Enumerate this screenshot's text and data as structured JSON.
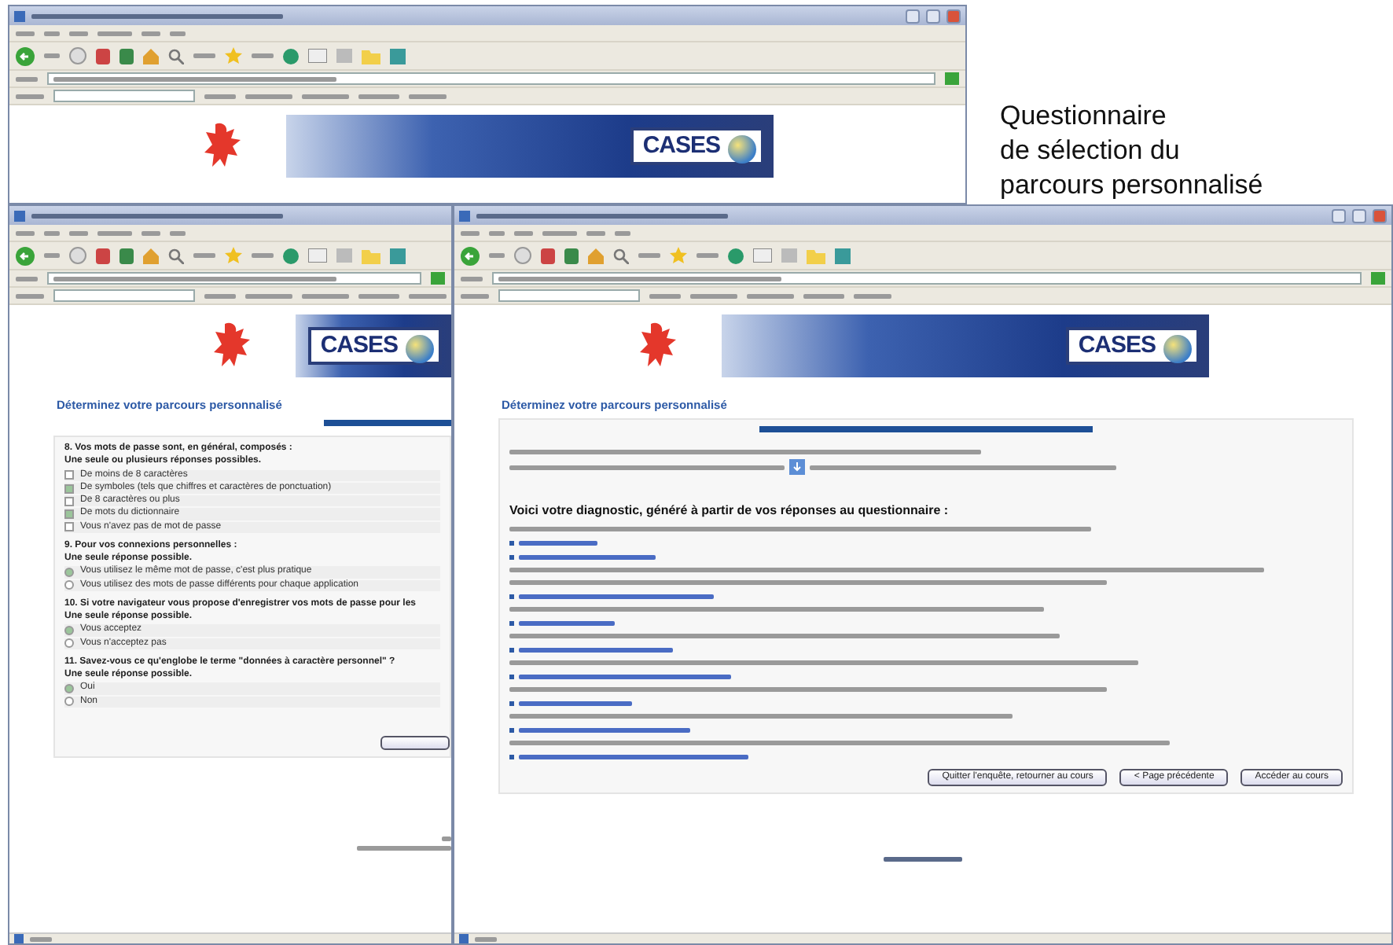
{
  "caption": "Questionnaire\nde sélection du\nparcours personnalisé",
  "windows": [
    {
      "kind": "banner",
      "window_buttons": true,
      "logo": "CASES"
    },
    {
      "kind": "questionnaire",
      "logo": "CASES",
      "heading": "Déterminez votre parcours personnalisé",
      "progress": {
        "level": 1
      },
      "questions": [
        {
          "title": "8. Vos mots de passe sont, en général, composés :",
          "hint": "Une seule ou plusieurs réponses possibles.",
          "kind": "checkbox",
          "options": [
            {
              "label": "De moins de 8 caractères",
              "checked": false
            },
            {
              "label": "De symboles (tels que chiffres et caractères de ponctuation)",
              "checked": true
            },
            {
              "label": "De 8 caractères ou plus",
              "checked": false
            },
            {
              "label": "De mots du dictionnaire",
              "checked": true
            },
            {
              "label": "Vous n'avez pas de mot de passe",
              "checked": false
            }
          ]
        },
        {
          "title": "9. Pour vos connexions personnelles :",
          "hint": "Une seule réponse possible.",
          "kind": "radio",
          "options": [
            {
              "label": "Vous utilisez le même mot de passe, c'est plus pratique",
              "selected": true
            },
            {
              "label": "Vous utilisez des mots de passe différents pour chaque application",
              "selected": false
            }
          ]
        },
        {
          "title": "10. Si votre navigateur vous propose d'enregistrer vos mots de passe pour les",
          "hint": "Une seule réponse possible.",
          "kind": "radio",
          "options": [
            {
              "label": "Vous acceptez",
              "selected": true
            },
            {
              "label": "Vous n'acceptez pas",
              "selected": false
            }
          ]
        },
        {
          "title": "11. Savez-vous ce qu'englobe le terme \"données à caractère personnel\" ?",
          "hint": "Une seule réponse possible.",
          "kind": "radio",
          "options": [
            {
              "label": "Oui",
              "selected": true
            },
            {
              "label": "Non",
              "selected": false
            }
          ]
        }
      ]
    },
    {
      "kind": "diagnostic",
      "window_buttons": true,
      "logo": "CASES",
      "heading": "Déterminez votre parcours personnalisé",
      "progress": {
        "level": 1
      },
      "diagnosis_title": "Voici votre diagnostic, généré à partir de vos réponses au questionnaire :",
      "lines": [
        {
          "kind": "text"
        },
        {
          "kind": "link"
        },
        {
          "kind": "link"
        },
        {
          "kind": "text"
        },
        {
          "kind": "text"
        },
        {
          "kind": "link"
        },
        {
          "kind": "text"
        },
        {
          "kind": "link"
        },
        {
          "kind": "text"
        },
        {
          "kind": "link"
        },
        {
          "kind": "text"
        },
        {
          "kind": "link"
        },
        {
          "kind": "text"
        },
        {
          "kind": "link"
        },
        {
          "kind": "text"
        },
        {
          "kind": "link"
        },
        {
          "kind": "text"
        },
        {
          "kind": "link"
        }
      ],
      "buttons": [
        "Quitter l'enquête, retourner au cours",
        "< Page précédente",
        "Accéder au cours"
      ]
    }
  ]
}
